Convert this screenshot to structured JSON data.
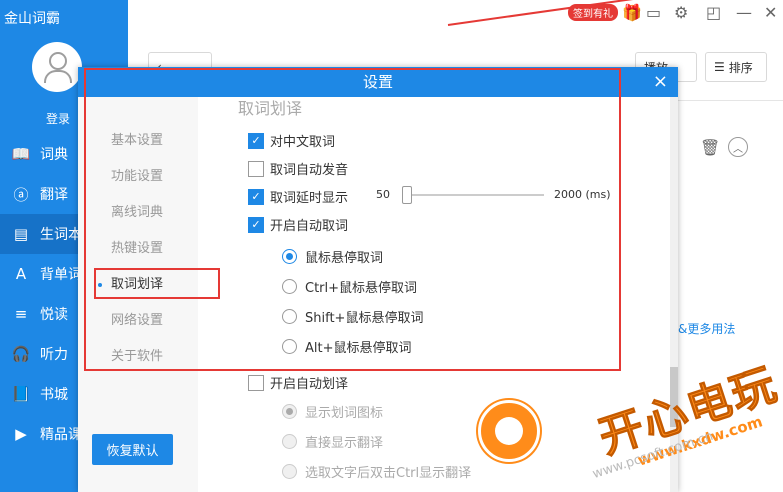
{
  "app": {
    "title": "金山词霸",
    "login": "登录"
  },
  "sidebar": {
    "items": [
      {
        "label": "词典",
        "icon": "📖"
      },
      {
        "label": "翻译",
        "icon": "ⓐ"
      },
      {
        "label": "生词本",
        "icon": "▤"
      },
      {
        "label": "背单词",
        "icon": "A"
      },
      {
        "label": "悦读",
        "icon": "≡"
      },
      {
        "label": "听力",
        "icon": "🎧"
      },
      {
        "label": "书城",
        "icon": "📘"
      },
      {
        "label": "精品课",
        "icon": "▶"
      }
    ]
  },
  "topbar": {
    "badge": "签到有礼"
  },
  "background": {
    "sort_label": "排序",
    "play_label": "播放",
    "link_text": "&更多用法"
  },
  "dialog": {
    "title": "设置",
    "close": "×",
    "side_items": [
      "基本设置",
      "功能设置",
      "离线词典",
      "热键设置",
      "取词划译",
      "网络设置",
      "关于软件"
    ],
    "restore_label": "恢复默认",
    "section_title": "取词划译",
    "options": {
      "chinese": "对中文取词",
      "auto_speak": "取词自动发音",
      "delay": "取词延时显示",
      "auto_pick": "开启自动取词",
      "radio1": "鼠标悬停取词",
      "radio2": "Ctrl+鼠标悬停取词",
      "radio3": "Shift+鼠标悬停取词",
      "radio4": "Alt+鼠标悬停取词",
      "auto_translate": "开启自动划译",
      "sub1": "显示划词图标",
      "sub2": "直接显示翻译",
      "sub3": "选取文字后双击Ctrl显示翻译"
    },
    "slider": {
      "min": "50",
      "max": "2000 (ms)",
      "value": 50
    }
  },
  "watermark": {
    "main": "开心电玩",
    "url": "www.kxdw.com",
    "url2": "www.pcsoft.com.cn"
  }
}
